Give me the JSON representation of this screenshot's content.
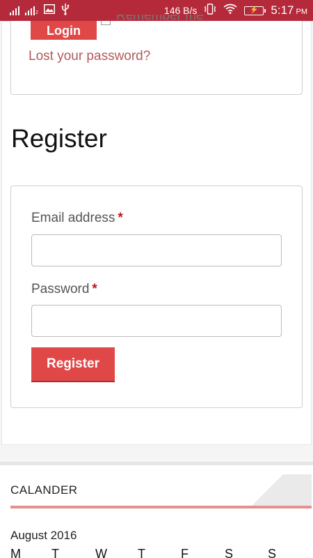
{
  "status_bar": {
    "speed": "146 B/s",
    "time": "5:17",
    "ampm": "PM",
    "sim2_sub": "2",
    "icons": [
      "signal-icon",
      "signal-icon",
      "image-icon",
      "usb-icon",
      "vibrate-icon",
      "wifi-icon",
      "battery-charging-icon"
    ]
  },
  "login": {
    "button_label": "Login",
    "remember_label": "Remember me",
    "lost_password": "Lost your password?"
  },
  "register": {
    "heading": "Register",
    "email_label": "Email address",
    "password_label": "Password",
    "required_mark": "*",
    "button_label": "Register"
  },
  "widget": {
    "title": "CALANDER",
    "month": "August 2016",
    "weekdays": [
      "M",
      "T",
      "W",
      "T",
      "F",
      "S",
      "S"
    ]
  },
  "colors": {
    "status_bar": "#b52a3a",
    "accent": "#e04848",
    "link": "#b25a5a",
    "required": "#c0141b"
  }
}
